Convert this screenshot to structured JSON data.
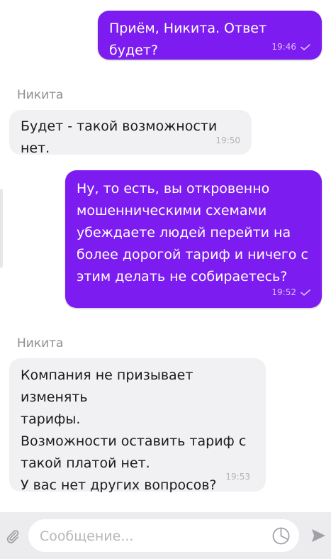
{
  "messages": [
    {
      "direction": "out",
      "text": "Приём, Никита. Ответ будет?",
      "time": "19:46"
    },
    {
      "direction": "in",
      "sender": "Никита",
      "text": "Будет - такой возможности нет.",
      "time": "19:50"
    },
    {
      "direction": "out",
      "text": "Ну, то есть, вы откровенно\nмошенническими схемами\nубеждаете людей перейти на\nболее дорогой тариф и ничего с\nэтим делать не собираетесь?",
      "time": "19:52"
    },
    {
      "direction": "in",
      "sender": "Никита",
      "text": "Компания не призывает изменять\nтарифы.\nВозможности оставить тариф с\nтакой платой нет.\nУ вас нет других вопросов?",
      "time": "19:53"
    }
  ],
  "composer": {
    "placeholder": "Сообщение...",
    "value": "",
    "icons": {
      "attach": "paperclip-icon",
      "sticker": "sticker-icon",
      "send": "send-icon"
    }
  },
  "colors": {
    "outgoing_bubble": "#7c1cf0",
    "incoming_bubble": "#f1f1f3",
    "composer_bar": "#ececee"
  }
}
